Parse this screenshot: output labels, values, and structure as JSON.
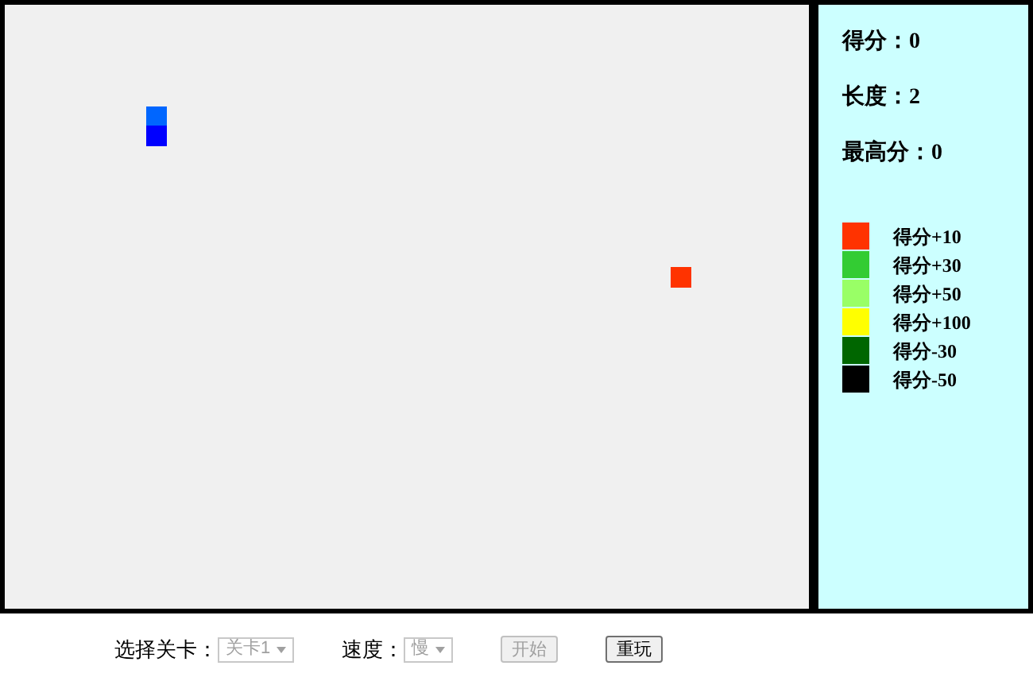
{
  "board": {
    "snake": [
      {
        "kind": "head"
      },
      {
        "kind": "body"
      }
    ],
    "food": {
      "color": "#ff3300"
    }
  },
  "stats": [
    {
      "label": "得分：",
      "value": "0"
    },
    {
      "label": "长度：",
      "value": "2"
    },
    {
      "label": "最高分：",
      "value": "0"
    }
  ],
  "legend": [
    {
      "color": "#ff3300",
      "label": "得分+10"
    },
    {
      "color": "#33cc33",
      "label": "得分+30"
    },
    {
      "color": "#99ff66",
      "label": "得分+50"
    },
    {
      "color": "#ffff00",
      "label": "得分+100"
    },
    {
      "color": "#006600",
      "label": "得分-30"
    },
    {
      "color": "#000000",
      "label": "得分-50"
    }
  ],
  "controls": {
    "level": {
      "label": "选择关卡：",
      "value": "关卡1",
      "disabled": true
    },
    "speed": {
      "label": "速度：",
      "value": "慢",
      "disabled": true
    },
    "buttons": [
      {
        "label": "开始",
        "disabled": true
      },
      {
        "label": "重玩",
        "disabled": false
      }
    ]
  }
}
